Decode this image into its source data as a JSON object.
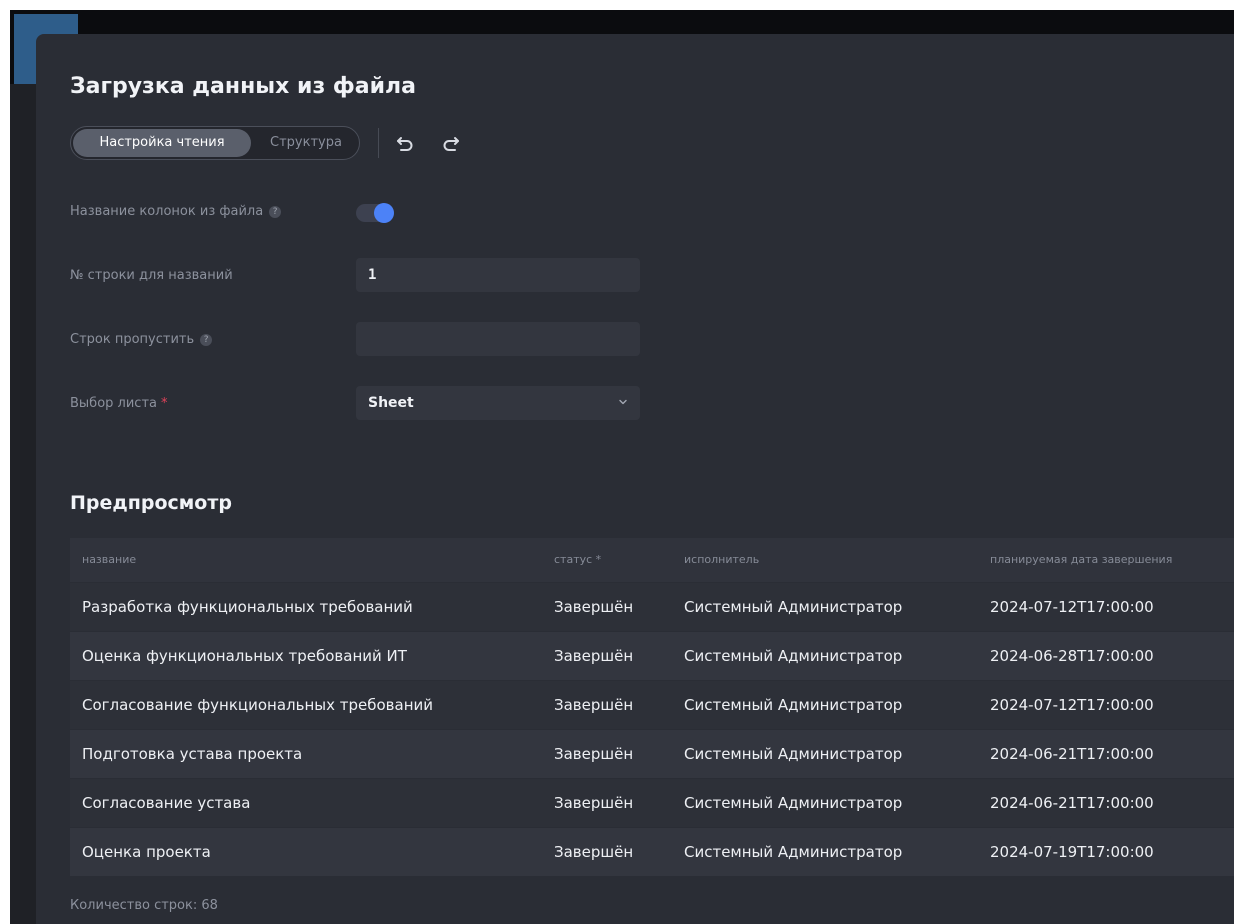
{
  "dialog": {
    "title": "Загрузка данных из файла"
  },
  "tabs": {
    "active": "Настройка чтения",
    "inactive": "Структура"
  },
  "toolbar": {
    "undo_icon": "undo-icon",
    "redo_icon": "redo-icon"
  },
  "settings": {
    "column_names_label": "Название колонок из файла",
    "column_names_enabled": true,
    "header_row_label": "№ строки для названий",
    "header_row_value": "1",
    "skip_rows_label": "Строк пропустить",
    "skip_rows_value": "",
    "sheet_label": "Выбор листа",
    "required_mark": "*",
    "help_mark": "?",
    "sheet_value": "Sheet"
  },
  "preview": {
    "title": "Предпросмотр",
    "columns": [
      "название",
      "статус *",
      "исполнитель",
      "планируемая дата завершения"
    ],
    "rows": [
      [
        "Разработка функциональных требований",
        "Завершён",
        "Системный Администратор",
        "2024-07-12T17:00:00"
      ],
      [
        "Оценка функциональных требований ИТ",
        "Завершён",
        "Системный Администратор",
        "2024-06-28T17:00:00"
      ],
      [
        "Согласование функциональных требований",
        "Завершён",
        "Системный Администратор",
        "2024-07-12T17:00:00"
      ],
      [
        "Подготовка устава проекта",
        "Завершён",
        "Системный Администратор",
        "2024-06-21T17:00:00"
      ],
      [
        "Согласование устава",
        "Завершён",
        "Системный Администратор",
        "2024-06-21T17:00:00"
      ],
      [
        "Оценка проекта",
        "Завершён",
        "Системный Администратор",
        "2024-07-19T17:00:00"
      ]
    ],
    "row_count": "Количество строк: 68"
  },
  "colors": {
    "modal_bg": "#2a2d35",
    "accent": "#4c82f7",
    "required": "#e2435a"
  }
}
